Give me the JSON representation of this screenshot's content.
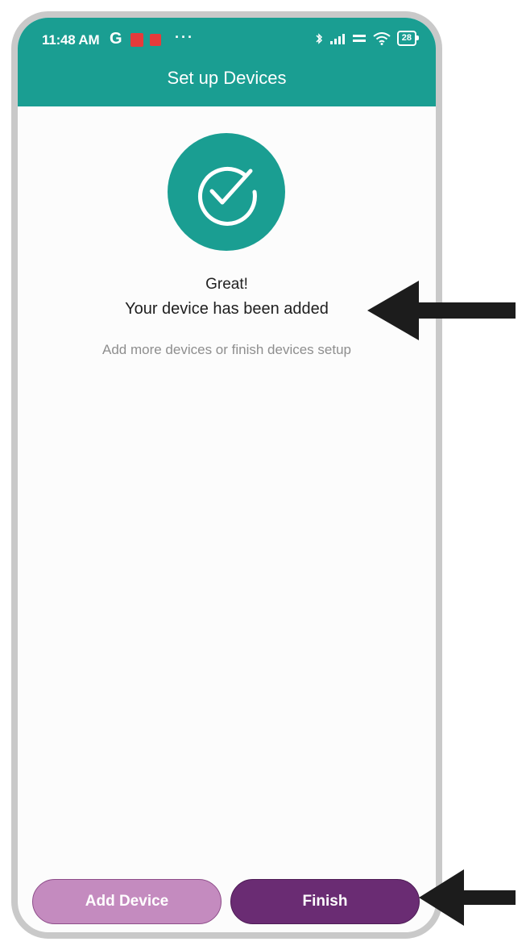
{
  "status_bar": {
    "time": "11:48 AM",
    "carrier_glyph": "G",
    "overflow": "···",
    "battery": "28",
    "icons": [
      "bluetooth-icon",
      "signal-icon",
      "vowifi-icon",
      "wifi-icon",
      "battery-icon"
    ]
  },
  "header": {
    "title": "Set up Devices"
  },
  "success": {
    "icon": "check-circle-icon",
    "line1": "Great!",
    "line2": "Your device has been added",
    "subtitle": "Add more devices or finish devices setup"
  },
  "buttons": {
    "add_device": "Add Device",
    "finish": "Finish"
  },
  "colors": {
    "accent": "#1a9e92",
    "primary_button": "#6a2c73",
    "secondary_button": "#c48bbf",
    "background": "#fcfcfc"
  }
}
